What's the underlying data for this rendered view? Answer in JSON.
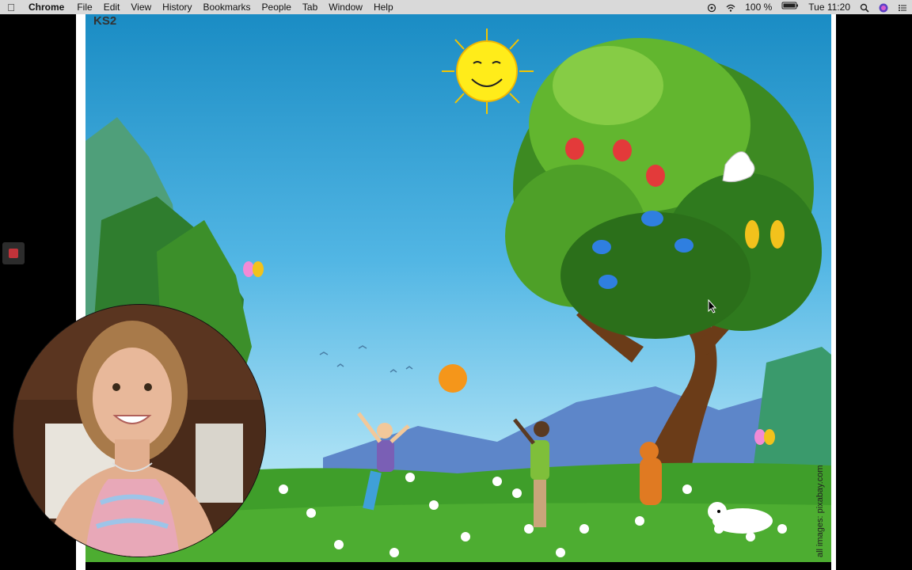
{
  "menubar": {
    "app_name": "Chrome",
    "menus": [
      "File",
      "Edit",
      "View",
      "History",
      "Bookmarks",
      "People",
      "Tab",
      "Window",
      "Help"
    ],
    "battery": "100 %",
    "clock": "Tue 11:20",
    "icons": [
      "apple-icon",
      "creative-cloud-icon",
      "wifi-icon",
      "battery-icon",
      "spotlight-icon",
      "siri-icon",
      "notification-center-icon"
    ]
  },
  "slide": {
    "label": "KS2",
    "credit": "all images: pixabay.com"
  },
  "colors": {
    "menubar_bg": "#d9d9d9",
    "sky_top": "#1a8cc4",
    "grass": "#3f9e2a",
    "record_red": "#c2333a"
  }
}
